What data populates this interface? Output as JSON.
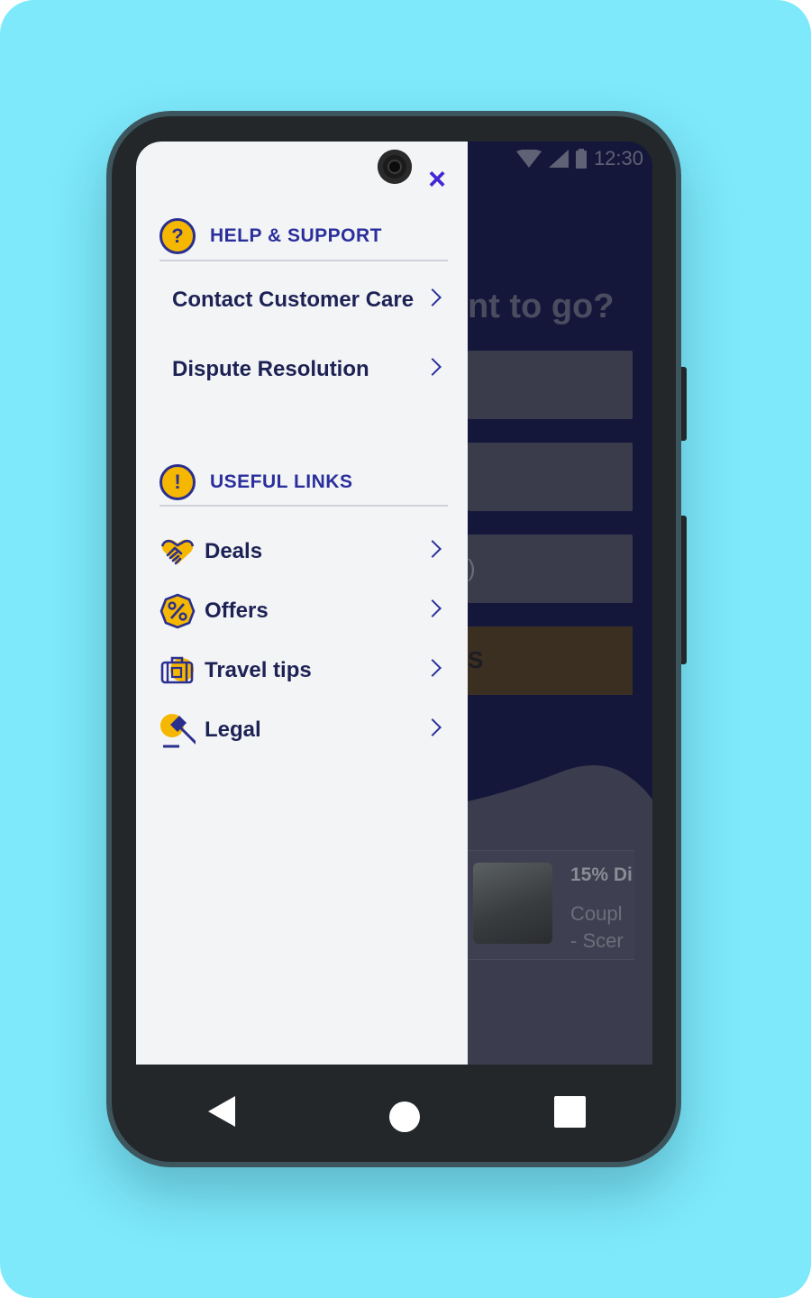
{
  "status_bar": {
    "time": "12:30"
  },
  "background_app": {
    "heading_fragment": "nt to go?",
    "field_fragment": ")",
    "cta_fragment": "S",
    "deal_card": {
      "title_fragment": "15% Di",
      "line1": "Coupl",
      "line2": "- Scer"
    }
  },
  "drawer": {
    "close_label": "×",
    "help_support": {
      "title": "HELP & SUPPORT",
      "icon_glyph": "?",
      "items": [
        {
          "label": "Contact Customer Care"
        },
        {
          "label": "Dispute Resolution"
        }
      ]
    },
    "useful_links": {
      "title": "USEFUL LINKS",
      "icon_glyph": "!",
      "items": [
        {
          "label": "Deals",
          "icon": "handshake-icon"
        },
        {
          "label": "Offers",
          "icon": "percent-badge-icon"
        },
        {
          "label": "Travel tips",
          "icon": "suitcase-icon"
        },
        {
          "label": "Legal",
          "icon": "gavel-icon"
        }
      ]
    }
  },
  "colors": {
    "page_background": "#7de9fb",
    "accent_yellow": "#f5b700",
    "brand_navy": "#2a2f9c",
    "close_purple": "#4326d6"
  }
}
